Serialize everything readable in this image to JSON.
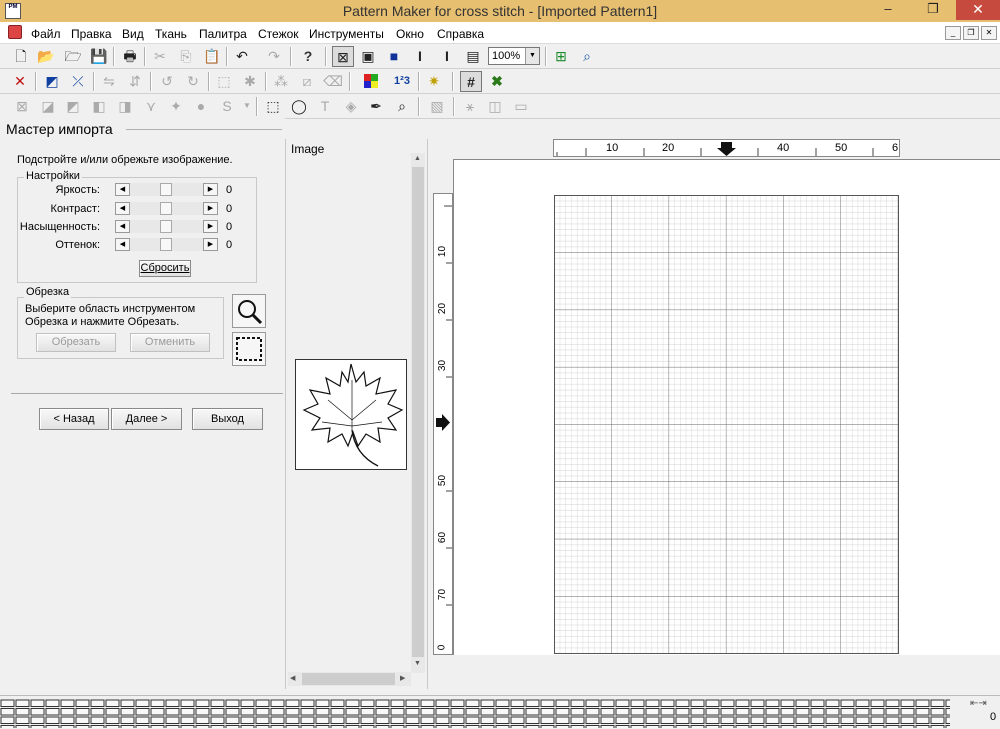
{
  "window": {
    "title": "Pattern Maker for cross stitch - [Imported Pattern1]",
    "app_icon_text": "PM"
  },
  "menu": {
    "items": [
      "Файл",
      "Правка",
      "Вид",
      "Ткань",
      "Палитра",
      "Стежок",
      "Инструменты",
      "Окно",
      "Справка"
    ]
  },
  "toolbar": {
    "zoom_value": "100%"
  },
  "wizard": {
    "title": "Мастер импорта",
    "instructions": "Подстройте и/или обрежьте изображение.",
    "settings_group": "Настройки",
    "sliders": [
      {
        "label": "Яркость:",
        "value": "0"
      },
      {
        "label": "Контраст:",
        "value": "0"
      },
      {
        "label": "Насыщенность:",
        "value": "0"
      },
      {
        "label": "Оттенок:",
        "value": "0"
      }
    ],
    "reset_label": "Сбросить",
    "crop_group": "Обрезка",
    "crop_text_1": "Выберите область инструментом",
    "crop_text_2": "Обрезка и нажмите Обрезать.",
    "crop_button": "Обрезать",
    "cancel_button": "Отменить",
    "back_button": "< Назад",
    "next_button": "Далее >",
    "exit_button": "Выход"
  },
  "image_panel": {
    "header": "Image"
  },
  "ruler": {
    "top_labels": [
      "10",
      "20",
      "40",
      "50",
      "6"
    ],
    "left_labels": [
      "10",
      "20",
      "30",
      "50",
      "60",
      "70",
      "0"
    ]
  },
  "status": {
    "value": "0"
  },
  "colors": {
    "titlebar": "#e7bf70",
    "close_button": "#c74a3f"
  }
}
